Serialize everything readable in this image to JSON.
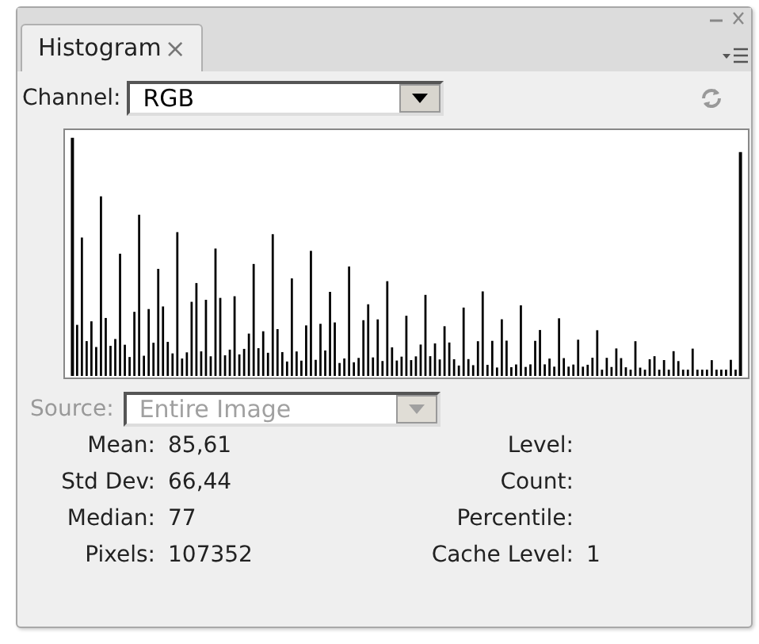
{
  "panel": {
    "tab": {
      "label": "Histogram",
      "close": "×"
    }
  },
  "channel": {
    "label": "Channel:",
    "value": "RGB"
  },
  "source": {
    "label": "Source:",
    "value": "Entire Image",
    "disabled": true
  },
  "stats_left": [
    {
      "label": "Mean:",
      "value": "85,61"
    },
    {
      "label": "Std Dev:",
      "value": "66,44"
    },
    {
      "label": "Median:",
      "value": "77"
    },
    {
      "label": "Pixels:",
      "value": "107352"
    }
  ],
  "stats_right": [
    {
      "label": "Level:"
    },
    {
      "label": "Count:"
    },
    {
      "label": "Percentile:"
    },
    {
      "label": "Cache Level:",
      "value": "1"
    }
  ]
}
